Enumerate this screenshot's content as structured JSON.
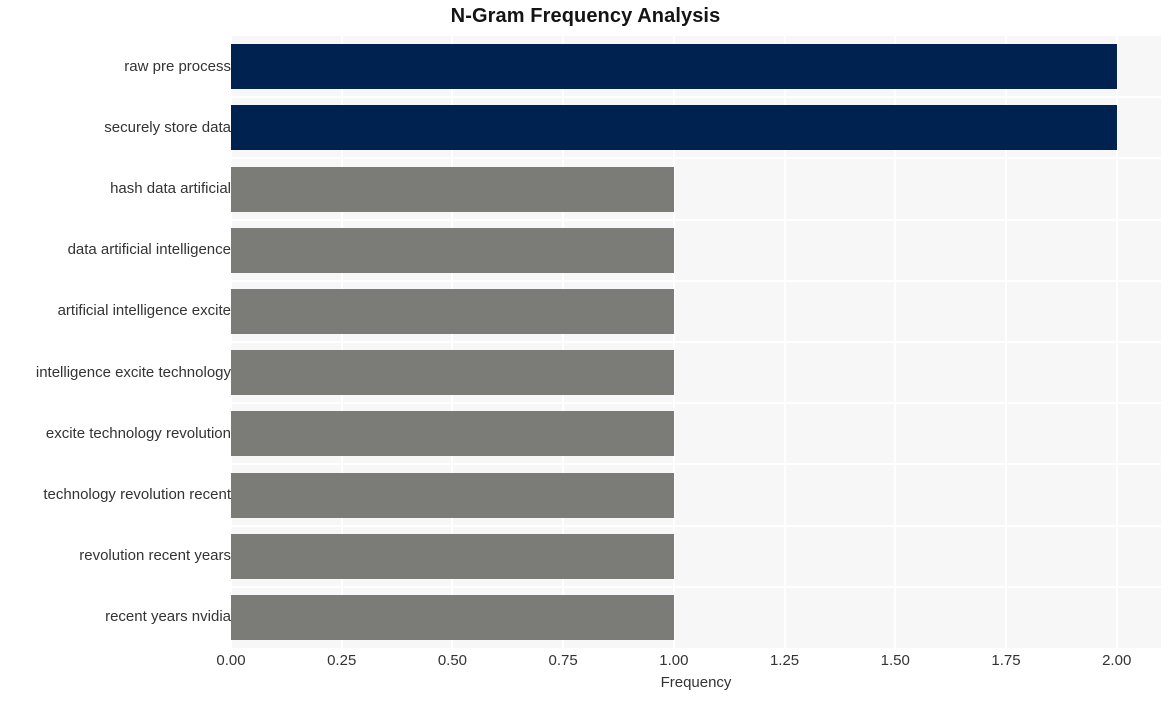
{
  "chart_data": {
    "type": "bar",
    "orientation": "horizontal",
    "title": "N-Gram Frequency Analysis",
    "xlabel": "Frequency",
    "ylabel": "",
    "categories": [
      "raw pre process",
      "securely store data",
      "hash data artificial",
      "data artificial intelligence",
      "artificial intelligence excite",
      "intelligence excite technology",
      "excite technology revolution",
      "technology revolution recent",
      "revolution recent years",
      "recent years nvidia"
    ],
    "values": [
      2,
      2,
      1,
      1,
      1,
      1,
      1,
      1,
      1,
      1
    ],
    "bar_colors": [
      "#002251",
      "#002251",
      "#7b7b78",
      "#7b7b78",
      "#7b7b78",
      "#7b7b78",
      "#7b7b78",
      "#7b7b78",
      "#7b7b78",
      "#7b7b78"
    ],
    "xlim": [
      0,
      2.1
    ],
    "xticks": [
      0,
      0.25,
      0.5,
      0.75,
      1.0,
      1.25,
      1.5,
      1.75,
      2.0
    ],
    "xtick_labels": [
      "0.00",
      "0.25",
      "0.50",
      "0.75",
      "1.00",
      "1.25",
      "1.50",
      "1.75",
      "2.00"
    ],
    "grid": true,
    "legend": "none",
    "plot_background": "#f7f7f8",
    "grid_color": "#ffffff",
    "figure_background": "#ffffff",
    "highlight_color": "#002251",
    "default_color": "#7b7b78"
  }
}
